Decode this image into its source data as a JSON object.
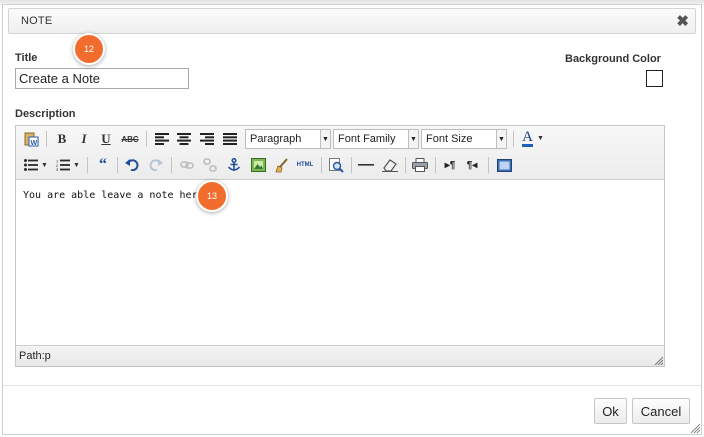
{
  "dialog": {
    "title": "NOTE",
    "close_glyph": "✖"
  },
  "form": {
    "title_label": "Title",
    "title_value": "Create a Note",
    "background_color_label": "Background Color",
    "description_label": "Description"
  },
  "toolbar": {
    "row1": {
      "buttons": [
        "paste-word-icon",
        "bold-icon",
        "italic-icon",
        "underline-icon",
        "strikethrough-icon",
        "align-left-icon",
        "align-center-icon",
        "align-right-icon",
        "align-justify-icon",
        "font-color-icon"
      ],
      "bold": "B",
      "italic": "I",
      "underline": "U",
      "strike": "ABC",
      "format_select": "Paragraph",
      "font_family_select": "Font Family",
      "font_size_select": "Font Size",
      "font_color": "A"
    },
    "row2": {
      "buttons": [
        "bullet-list-icon",
        "numbered-list-icon",
        "blockquote-icon",
        "undo-icon",
        "redo-icon",
        "link-icon",
        "unlink-icon",
        "anchor-icon",
        "image-icon",
        "cleanup-icon",
        "html-source-icon",
        "search-replace-icon",
        "horizontal-rule-icon",
        "remove-format-icon",
        "print-icon",
        "ltr-icon",
        "rtl-icon",
        "fullscreen-icon"
      ],
      "html_label": "HTML"
    }
  },
  "editor": {
    "content": "You are able leave a note here...",
    "path": "Path:p"
  },
  "badges": {
    "first": "12",
    "second": "13"
  },
  "buttons": {
    "ok": "Ok",
    "cancel": "Cancel"
  },
  "colors": {
    "badge": "#f26d2d",
    "underline_accent": "#1c5fb8"
  }
}
